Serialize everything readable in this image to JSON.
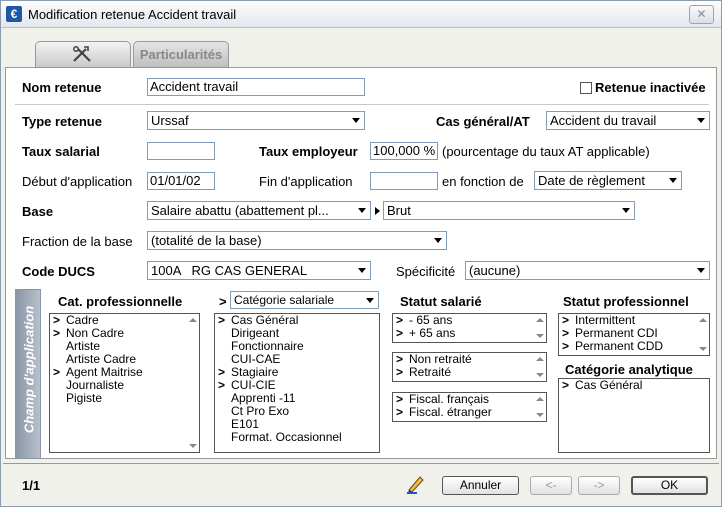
{
  "window": {
    "title": "Modification retenue Accident travail",
    "app_icon_letter": "€",
    "close_glyph": "✕"
  },
  "tabs": {
    "tab1_icon": "tools-icon",
    "tab2_label": "Particularités"
  },
  "form": {
    "nom_retenue_label": "Nom retenue",
    "nom_retenue_value": "Accident travail",
    "retenue_inactivee_label": "Retenue inactivée",
    "type_retenue_label": "Type retenue",
    "type_retenue_value": "Urssaf",
    "cas_general_label": "Cas général/AT",
    "cas_general_value": "Accident du travail",
    "taux_salarial_label": "Taux salarial",
    "taux_salarial_value": "",
    "taux_employeur_label": "Taux employeur",
    "taux_employeur_value": "100,000 %",
    "taux_employeur_note": "(pourcentage du taux AT applicable)",
    "debut_label": "Début d'application",
    "debut_value": "01/01/02",
    "fin_label": "Fin d'application",
    "fin_value": "",
    "en_fonction_label": "en fonction de",
    "en_fonction_value": "Date de règlement",
    "base_label": "Base",
    "base_value": "Salaire abattu (abattement pl...",
    "base_value2": "Brut",
    "fraction_label": "Fraction de la base",
    "fraction_value": "(totalité de la base)",
    "code_ducs_label": "Code DUCS",
    "code_ducs_value": "100A   RG CAS GENERAL",
    "specificite_label": "Spécificité",
    "specificite_value": "(aucune)"
  },
  "champ": {
    "side_label": "Champ d'application",
    "cat_pro_header": "Cat. professionnelle",
    "cat_pro_items": [
      {
        "mark": ">",
        "text": "Cadre"
      },
      {
        "mark": ">",
        "text": "Non Cadre"
      },
      {
        "mark": "",
        "text": "Artiste"
      },
      {
        "mark": "",
        "text": "Artiste Cadre"
      },
      {
        "mark": ">",
        "text": "Agent Maitrise"
      },
      {
        "mark": "",
        "text": "Journaliste"
      },
      {
        "mark": "",
        "text": "Pigiste"
      }
    ],
    "cat_sal_mark": ">",
    "cat_sal_select": "Catégorie salariale",
    "cat_sal_items": [
      {
        "mark": ">",
        "text": "Cas Général"
      },
      {
        "mark": "",
        "text": "Dirigeant"
      },
      {
        "mark": "",
        "text": "Fonctionnaire"
      },
      {
        "mark": "",
        "text": "CUI-CAE"
      },
      {
        "mark": ">",
        "text": "Stagiaire"
      },
      {
        "mark": ">",
        "text": "CUI-CIE"
      },
      {
        "mark": "",
        "text": "Apprenti -11"
      },
      {
        "mark": "",
        "text": "Ct Pro Exo"
      },
      {
        "mark": "",
        "text": "E101"
      },
      {
        "mark": "",
        "text": "Format. Occasionnel"
      }
    ],
    "statut_sal_header": "Statut salarié",
    "age_items": [
      {
        "mark": ">",
        "text": "- 65 ans"
      },
      {
        "mark": ">",
        "text": "+ 65 ans"
      }
    ],
    "retraite_items": [
      {
        "mark": ">",
        "text": "Non retraité"
      },
      {
        "mark": ">",
        "text": "Retraité"
      }
    ],
    "fiscal_items": [
      {
        "mark": ">",
        "text": "Fiscal. français"
      },
      {
        "mark": ">",
        "text": "Fiscal. étranger"
      }
    ],
    "statut_pro_header": "Statut professionnel",
    "statut_pro_items": [
      {
        "mark": ">",
        "text": "Intermittent"
      },
      {
        "mark": ">",
        "text": "Permanent CDI"
      },
      {
        "mark": ">",
        "text": "Permanent CDD"
      }
    ],
    "cat_ana_header": "Catégorie analytique",
    "cat_ana_items": [
      {
        "mark": ">",
        "text": "Cas Général"
      }
    ]
  },
  "footer": {
    "page": "1/1",
    "annuler": "Annuler",
    "prev": "<-",
    "next": "->",
    "ok": "OK"
  }
}
